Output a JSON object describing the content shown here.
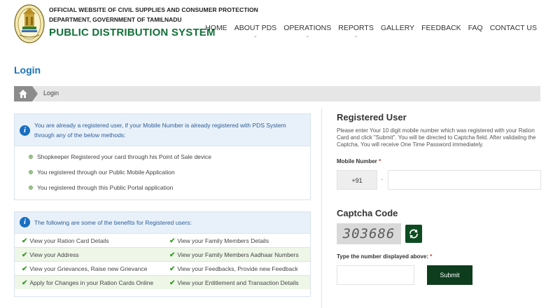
{
  "header": {
    "dept_line1": "OFFICIAL WEBSITE OF CIVIL SUPPLIES AND CONSUMER PROTECTION",
    "dept_line2": "DEPARTMENT, GOVERNMENT OF TAMILNADU",
    "brand": "PUBLIC DISTRIBUTION SYSTEM",
    "nav": [
      {
        "label": "HOME",
        "has_dropdown": false
      },
      {
        "label": "ABOUT PDS",
        "has_dropdown": true
      },
      {
        "label": "OPERATIONS",
        "has_dropdown": true
      },
      {
        "label": "REPORTS",
        "has_dropdown": true
      },
      {
        "label": "GALLERY",
        "has_dropdown": false
      },
      {
        "label": "FEEDBACK",
        "has_dropdown": false
      },
      {
        "label": "FAQ",
        "has_dropdown": false
      },
      {
        "label": "CONTACT US",
        "has_dropdown": false
      }
    ]
  },
  "page": {
    "title": "Login",
    "breadcrumb": "Login"
  },
  "registered_info": {
    "message": "You are already a registered user, if your Mobile Number is already registered with PDS System through any of the below methods:",
    "methods": [
      "Shopkeeper Registered your card through his Point of Sale device",
      "You registered through our Public Mobile Application",
      "You registered through this Public Portal application"
    ]
  },
  "benefits": {
    "message": "The following are some of the benefits for Registered users:",
    "rows": [
      [
        "View your Ration Card Details",
        "View your Family Members Details"
      ],
      [
        "View your Address",
        "View your Family Members Aadhaar Numbers"
      ],
      [
        "View your Grievances, Raise new Grievance",
        "View your Feedbacks, Provide new Feedback"
      ],
      [
        "Apply for Changes in your Ration Cards Online",
        "View your Entitlement and Transaction Details"
      ]
    ]
  },
  "registered_user": {
    "title": "Registered User",
    "description": "Please enter Your 10 digit mobile number which was registered with your Ration Card and click \"Submit\". You will be directed to Captcha field. After validating the Captcha, You will receive One Time Password immediately.",
    "mobile_label": "Mobile Number",
    "required_mark": "*",
    "country_code": "+91",
    "separator": "-",
    "mobile_value": ""
  },
  "captcha": {
    "title": "Captcha Code",
    "code": "303686",
    "input_label": "Type the number displayed above:",
    "required_mark": "*",
    "input_value": "",
    "submit_label": "Submit"
  },
  "colors": {
    "brand_green": "#14703a",
    "title_blue": "#1a73b8",
    "info_blue": "#2e5d96",
    "button_dark_green": "#0e3d1e",
    "check_green": "#3d9a2f"
  },
  "icons": {
    "home": "home-icon",
    "info": "info-icon",
    "check": "check-icon",
    "refresh": "refresh-icon"
  }
}
